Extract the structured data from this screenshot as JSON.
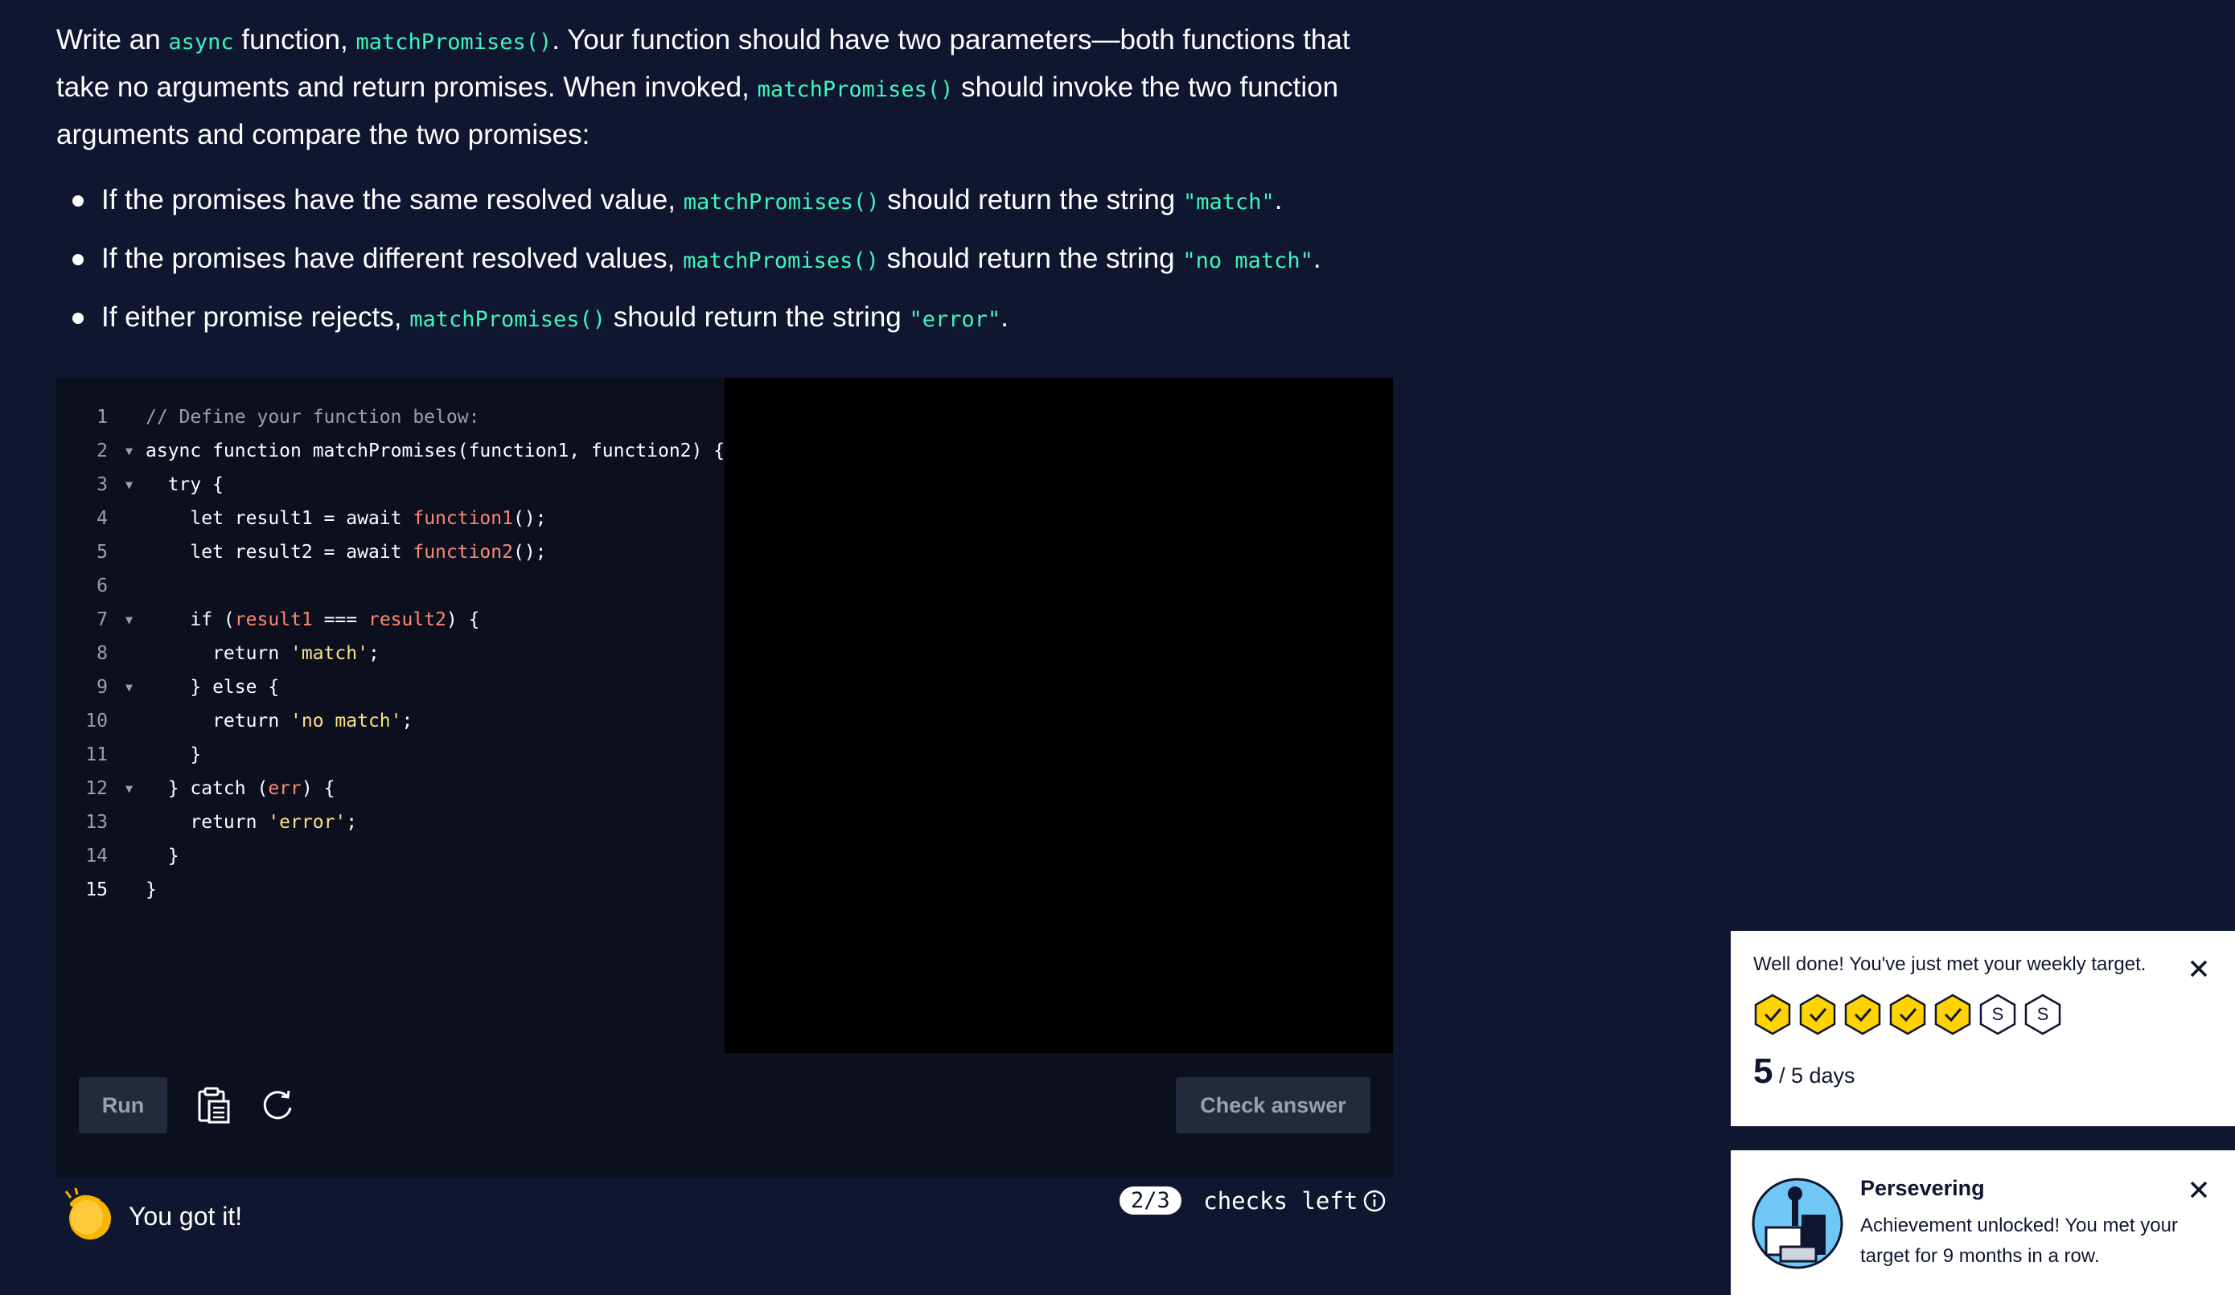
{
  "instructions": {
    "intro_part1": "Write an ",
    "intro_code1": "async",
    "intro_part2": " function, ",
    "intro_code2": "matchPromises()",
    "intro_part3": ". Your function should have two parameters—both functions that take no arguments and return promises. When invoked, ",
    "intro_code3": "matchPromises()",
    "intro_part4": " should invoke the two function arguments and compare the two promises:",
    "bullets": [
      {
        "pre": "If the promises have the same resolved value, ",
        "code": "matchPromises()",
        "mid": " should return the string ",
        "str": "\"match\"",
        "post": "."
      },
      {
        "pre": "If the promises have different resolved values, ",
        "code": "matchPromises()",
        "mid": " should return the string ",
        "str": "\"no match\"",
        "post": "."
      },
      {
        "pre": "If either promise rejects, ",
        "code": "matchPromises()",
        "mid": " should return the string ",
        "str": "\"error\"",
        "post": "."
      }
    ]
  },
  "editor": {
    "line_numbers": [
      "1",
      "2",
      "3",
      "4",
      "5",
      "6",
      "7",
      "8",
      "9",
      "10",
      "11",
      "12",
      "13",
      "14",
      "15"
    ],
    "fold_marker": "▼",
    "l1": "// Define your function below:",
    "l2": "async function matchPromises(function1, function2) {",
    "l3": "  try {",
    "l4_a": "    let result1 = await ",
    "l4_fn": "function1",
    "l4_b": "();",
    "l5_a": "    let result2 = await ",
    "l5_fn": "function2",
    "l5_b": "();",
    "l7_a": "    if (",
    "l7_v1": "result1",
    "l7_op": " === ",
    "l7_v2": "result2",
    "l7_b": ") {",
    "l8_a": "      return ",
    "l8_s": "'match'",
    "l8_b": ";",
    "l9": "    } else {",
    "l10_a": "      return ",
    "l10_s": "'no match'",
    "l10_b": ";",
    "l11": "    }",
    "l12_a": "  } catch (",
    "l12_v": "err",
    "l12_b": ") {",
    "l13_a": "    return ",
    "l13_s": "'error'",
    "l13_b": ";",
    "l14": "  }",
    "l15": "}"
  },
  "toolbar": {
    "run_label": "Run",
    "check_label": "Check answer",
    "clipboard_icon": "clipboard-icon",
    "reset_icon": "reset-icon"
  },
  "result": {
    "emoji": "👏",
    "message": "You got it!"
  },
  "checks": {
    "count": "2/3",
    "label": " checks left"
  },
  "weekly_toast": {
    "message": "Well done! You've just met your weekly target.",
    "days_done": 5,
    "days_total": 7,
    "skip_label": "S",
    "count": "5",
    "suffix": " / 5 days"
  },
  "achievement_toast": {
    "title": "Persevering",
    "message": "Achievement unlocked! You met your target for 9 months in a row."
  },
  "colors": {
    "background": "#10162f",
    "accent_code": "#3df7bd",
    "hex_yellow": "#ffd300"
  }
}
